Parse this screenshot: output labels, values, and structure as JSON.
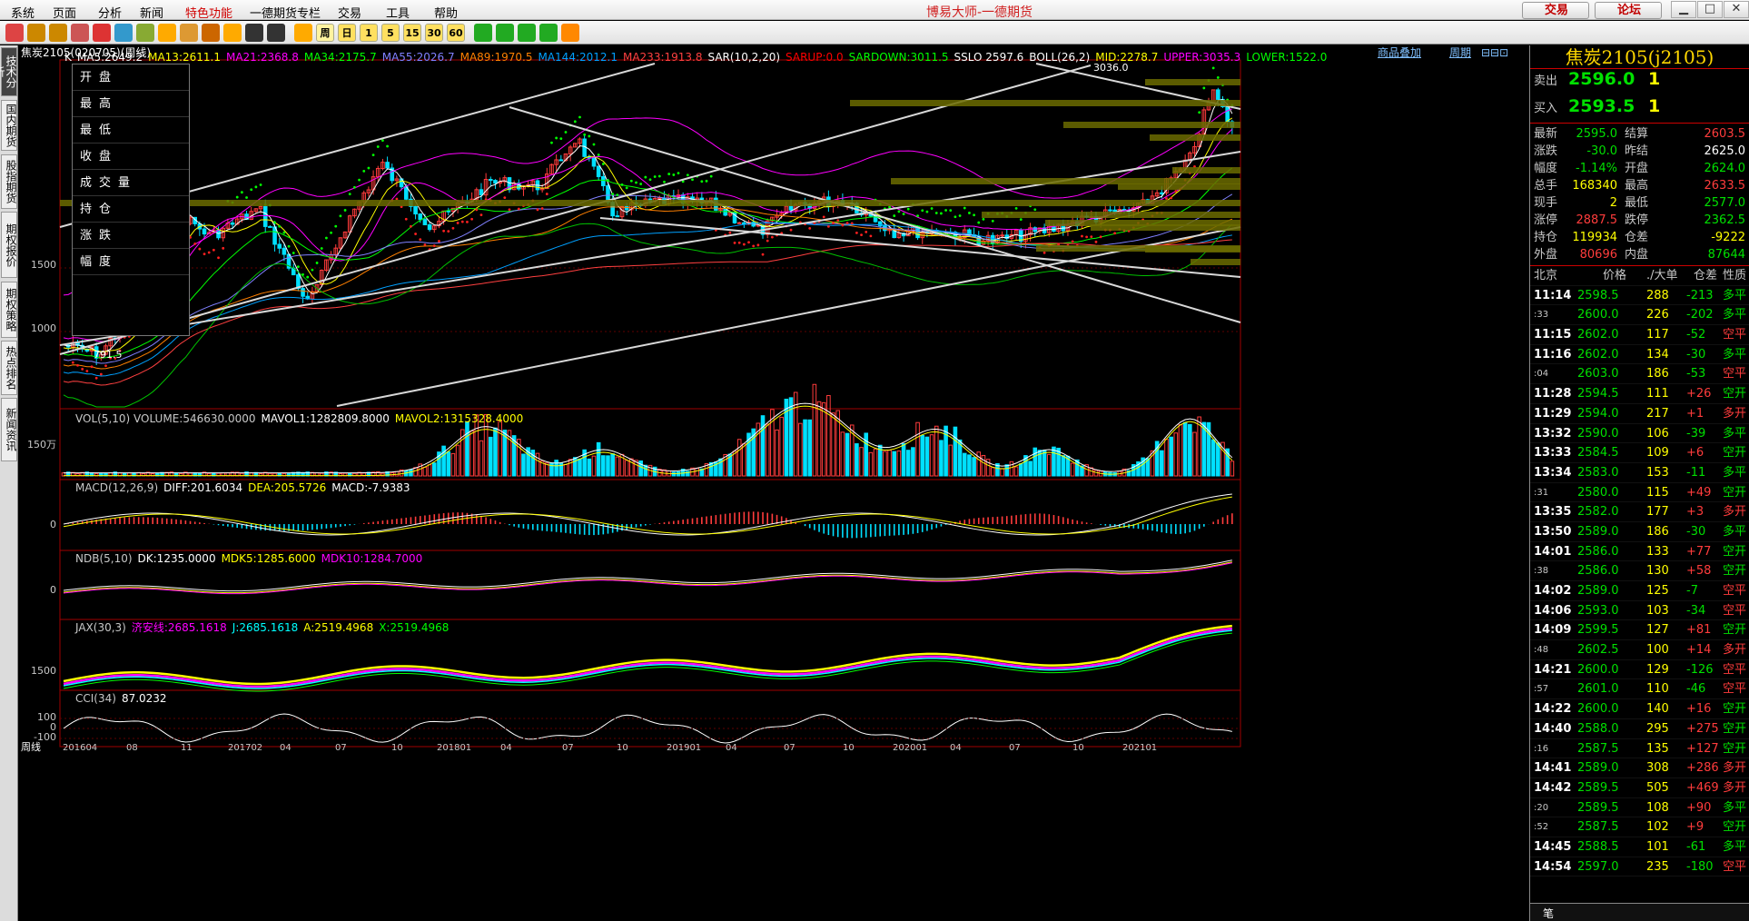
{
  "app": {
    "title": "博易大师-一德期货"
  },
  "menu": [
    "系统",
    "页面",
    "分析",
    "新闻",
    "特色功能",
    "一德期货专栏",
    "交易",
    "工具",
    "帮助"
  ],
  "buttons": {
    "trade": "交易",
    "forum": "论坛"
  },
  "toolbar": {
    "period_buttons": [
      "周",
      "日",
      "1",
      "5",
      "15",
      "30",
      "60"
    ]
  },
  "side_tabs": [
    "技术分析",
    "国内期货",
    "股指期货",
    "期权报价",
    "期权策略",
    "热点排名",
    "新闻资讯"
  ],
  "chart": {
    "instrument_title": "焦炭2105(020705)(周线)",
    "top_right_links": [
      "商品叠加",
      "周期"
    ],
    "info_rows": [
      "开盘",
      "最高",
      "最低",
      "收盘",
      "成交量",
      "持仓",
      "涨跌",
      "幅度"
    ],
    "main_indicators": [
      {
        "text": "K",
        "color": "#ffffff"
      },
      {
        "text": "MA5:2649.2",
        "color": "#ffffff"
      },
      {
        "text": "MA13:2611.1",
        "color": "#ffff00"
      },
      {
        "text": "MA21:2368.8",
        "color": "#ff00ff"
      },
      {
        "text": "MA34:2175.7",
        "color": "#00ff00"
      },
      {
        "text": "MA55:2026.7",
        "color": "#8080ff"
      },
      {
        "text": "MA89:1970.5",
        "color": "#ff8000"
      },
      {
        "text": "MA144:2012.1",
        "color": "#00a0ff"
      },
      {
        "text": "MA233:1913.8",
        "color": "#ff4040"
      },
      {
        "text": "SAR(10,2,20)",
        "color": "#ffffff"
      },
      {
        "text": "SARUP:0.0",
        "color": "#ff0000"
      },
      {
        "text": "SARDOWN:3011.5",
        "color": "#00ff00"
      },
      {
        "text": "SSLO 2597.6",
        "color": "#ffffff"
      },
      {
        "text": "BOLL(26,2)",
        "color": "#ffffff"
      },
      {
        "text": "MID:2278.7",
        "color": "#ffff00"
      },
      {
        "text": "UPPER:3035.3",
        "color": "#ff00ff"
      },
      {
        "text": "LOWER:1522.0",
        "color": "#00ff00"
      }
    ],
    "main_yaxis": [
      "1500",
      "1000"
    ],
    "annotations": {
      "high": "3036.0",
      "low": "791.5"
    },
    "vol": {
      "labels": [
        {
          "text": "VOL(5,10) VOLUME:546630.0000",
          "color": "#c8c8c8"
        },
        {
          "text": "MAVOL1:1282809.8000",
          "color": "#ffffff"
        },
        {
          "text": "MAVOL2:1315328.4000",
          "color": "#ffff00"
        }
      ],
      "yaxis": "150万"
    },
    "macd": {
      "labels": [
        {
          "text": "MACD(12,26,9)",
          "color": "#c8c8c8"
        },
        {
          "text": "DIFF:201.6034",
          "color": "#ffffff"
        },
        {
          "text": "DEA:205.5726",
          "color": "#ffff00"
        },
        {
          "text": "MACD:-7.9383",
          "color": "#ffffff"
        }
      ],
      "yaxis": "0"
    },
    "ndb": {
      "labels": [
        {
          "text": "NDB(5,10)",
          "color": "#c8c8c8"
        },
        {
          "text": "DK:1235.0000",
          "color": "#ffffff"
        },
        {
          "text": "MDK5:1285.6000",
          "color": "#ffff00"
        },
        {
          "text": "MDK10:1284.7000",
          "color": "#ff00ff"
        }
      ],
      "yaxis": "0"
    },
    "jax": {
      "labels": [
        {
          "text": "JAX(30,3)",
          "color": "#c8c8c8"
        },
        {
          "text": "济安线:2685.1618",
          "color": "#ff00ff"
        },
        {
          "text": "J:2685.1618",
          "color": "#00ffff"
        },
        {
          "text": "A:2519.4968",
          "color": "#ffff00"
        },
        {
          "text": "X:2519.4968",
          "color": "#00ff00"
        }
      ],
      "yaxis": "1500"
    },
    "cci": {
      "labels": [
        {
          "text": "CCI(34)",
          "color": "#c8c8c8"
        },
        {
          "text": "87.0232",
          "color": "#ffffff"
        }
      ],
      "yaxis": [
        "100",
        "0",
        "-100"
      ]
    },
    "xaxis_label": "周线",
    "xaxis": [
      "201604",
      "08",
      "11",
      "201702",
      "04",
      "07",
      "10",
      "201801",
      "04",
      "07",
      "10",
      "201901",
      "04",
      "07",
      "10",
      "202001",
      "04",
      "07",
      "10",
      "202101"
    ]
  },
  "quote": {
    "title": "焦炭2105(j2105)",
    "sell": {
      "label": "卖出",
      "price": "2596.0",
      "qty": "1"
    },
    "buy": {
      "label": "买入",
      "price": "2593.5",
      "qty": "1"
    },
    "fields": [
      {
        "l1": "最新",
        "v1": "2595.0",
        "c1": "green",
        "l2": "结算",
        "v2": "2603.5",
        "c2": "red"
      },
      {
        "l1": "涨跌",
        "v1": "-30.0",
        "c1": "green",
        "l2": "昨结",
        "v2": "2625.0",
        "c2": "white"
      },
      {
        "l1": "幅度",
        "v1": "-1.14%",
        "c1": "green",
        "l2": "开盘",
        "v2": "2624.0",
        "c2": "green"
      },
      {
        "l1": "总手",
        "v1": "168340",
        "c1": "yellow",
        "l2": "最高",
        "v2": "2633.5",
        "c2": "red"
      },
      {
        "l1": "现手",
        "v1": "2",
        "c1": "yellow",
        "l2": "最低",
        "v2": "2577.0",
        "c2": "green"
      },
      {
        "l1": "涨停",
        "v1": "2887.5",
        "c1": "red",
        "l2": "跌停",
        "v2": "2362.5",
        "c2": "green"
      },
      {
        "l1": "持仓",
        "v1": "119934",
        "c1": "yellow",
        "l2": "仓差",
        "v2": "-9222",
        "c2": "yellow"
      },
      {
        "l1": "外盘",
        "v1": "80696",
        "c1": "red",
        "l2": "内盘",
        "v2": "87644",
        "c2": "green"
      }
    ],
    "tick_header": {
      "time": "北京",
      "price": "价格",
      "vol": "./大单",
      "oi": "仓差",
      "nature": "性质"
    },
    "ticks": [
      {
        "t": "11:14",
        "p": "2598.5",
        "v": "288",
        "d": "-213",
        "n": "多平",
        "nc": "green"
      },
      {
        "t": ":33",
        "p": "2600.0",
        "v": "226",
        "d": "-202",
        "n": "多平",
        "nc": "green"
      },
      {
        "t": "11:15",
        "p": "2602.0",
        "v": "117",
        "d": "-52",
        "n": "空平",
        "nc": "red"
      },
      {
        "t": "11:16",
        "p": "2602.0",
        "v": "134",
        "d": "-30",
        "n": "多平",
        "nc": "green"
      },
      {
        "t": ":04",
        "p": "2603.0",
        "v": "186",
        "d": "-53",
        "n": "空平",
        "nc": "red"
      },
      {
        "t": "11:28",
        "p": "2594.5",
        "v": "111",
        "d": "+26",
        "n": "空开",
        "nc": "green"
      },
      {
        "t": "11:29",
        "p": "2594.0",
        "v": "217",
        "d": "+1",
        "n": "多开",
        "nc": "red"
      },
      {
        "t": "13:32",
        "p": "2590.0",
        "v": "106",
        "d": "-39",
        "n": "多平",
        "nc": "green"
      },
      {
        "t": "13:33",
        "p": "2584.5",
        "v": "109",
        "d": "+6",
        "n": "空开",
        "nc": "green"
      },
      {
        "t": "13:34",
        "p": "2583.0",
        "v": "153",
        "d": "-11",
        "n": "多平",
        "nc": "green"
      },
      {
        "t": ":31",
        "p": "2580.0",
        "v": "115",
        "d": "+49",
        "n": "空开",
        "nc": "green"
      },
      {
        "t": "13:35",
        "p": "2582.0",
        "v": "177",
        "d": "+3",
        "n": "多开",
        "nc": "red"
      },
      {
        "t": "13:50",
        "p": "2589.0",
        "v": "186",
        "d": "-30",
        "n": "多平",
        "nc": "green"
      },
      {
        "t": "14:01",
        "p": "2586.0",
        "v": "133",
        "d": "+77",
        "n": "空开",
        "nc": "green"
      },
      {
        "t": ":38",
        "p": "2586.0",
        "v": "130",
        "d": "+58",
        "n": "空开",
        "nc": "green"
      },
      {
        "t": "14:02",
        "p": "2589.0",
        "v": "125",
        "d": "-7",
        "n": "空平",
        "nc": "red"
      },
      {
        "t": "14:06",
        "p": "2593.0",
        "v": "103",
        "d": "-34",
        "n": "空平",
        "nc": "red"
      },
      {
        "t": "14:09",
        "p": "2599.5",
        "v": "127",
        "d": "+81",
        "n": "空开",
        "nc": "green"
      },
      {
        "t": ":48",
        "p": "2602.5",
        "v": "100",
        "d": "+14",
        "n": "多开",
        "nc": "red"
      },
      {
        "t": "14:21",
        "p": "2600.0",
        "v": "129",
        "d": "-126",
        "n": "空平",
        "nc": "red"
      },
      {
        "t": ":57",
        "p": "2601.0",
        "v": "110",
        "d": "-46",
        "n": "空平",
        "nc": "red"
      },
      {
        "t": "14:22",
        "p": "2600.0",
        "v": "140",
        "d": "+16",
        "n": "空开",
        "nc": "green"
      },
      {
        "t": "14:40",
        "p": "2588.0",
        "v": "295",
        "d": "+275",
        "n": "空开",
        "nc": "green"
      },
      {
        "t": ":16",
        "p": "2587.5",
        "v": "135",
        "d": "+127",
        "n": "空开",
        "nc": "green"
      },
      {
        "t": "14:41",
        "p": "2589.0",
        "v": "308",
        "d": "+286",
        "n": "多开",
        "nc": "red"
      },
      {
        "t": "14:42",
        "p": "2589.5",
        "v": "505",
        "d": "+469",
        "n": "多开",
        "nc": "red"
      },
      {
        "t": ":20",
        "p": "2589.5",
        "v": "108",
        "d": "+90",
        "n": "多平",
        "nc": "green"
      },
      {
        "t": ":52",
        "p": "2587.5",
        "v": "102",
        "d": "+9",
        "n": "空开",
        "nc": "green"
      },
      {
        "t": "14:45",
        "p": "2588.5",
        "v": "101",
        "d": "-61",
        "n": "多平",
        "nc": "green"
      },
      {
        "t": "14:54",
        "p": "2597.0",
        "v": "235",
        "d": "-180",
        "n": "空平",
        "nc": "red"
      }
    ],
    "bottom_tab": "笔"
  }
}
